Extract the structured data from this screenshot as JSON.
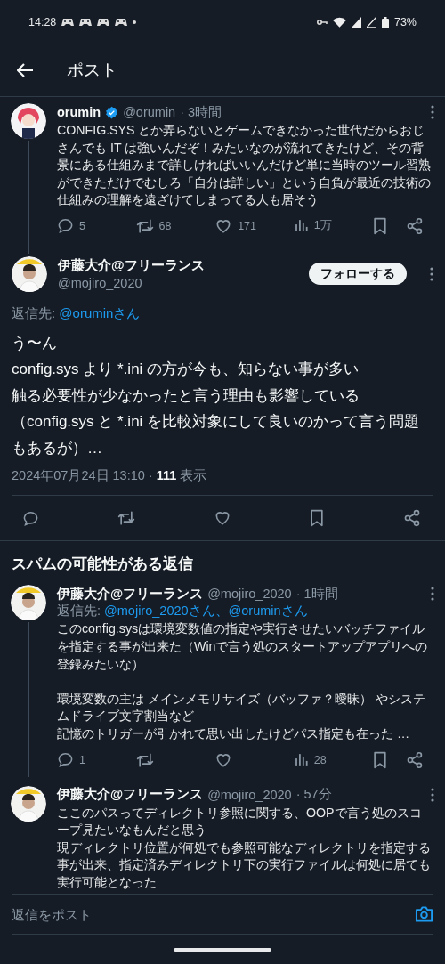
{
  "status_bar": {
    "time": "14:28",
    "battery": "73%"
  },
  "header": {
    "title": "ポスト"
  },
  "parent_post": {
    "name": "orumin",
    "verified": true,
    "handle": "@orumin",
    "time": "· 3時間",
    "connected": true,
    "paragraphs": [
      [
        "CONFIG.SYS とか弄らないとゲームできなかった世代だからおじさんでも IT は強いんだぞ！みたいなのが流れてきたけど、その背景にある仕組みまで詳しければいいんだけど単に当時のツール習熟ができただけでむしろ「自分は詳しい」という自負が最近の技術の仕組みの理解を遠ざけてしまってる人も居そう"
      ]
    ],
    "stats": {
      "replies": "5",
      "reposts": "68",
      "likes": "171",
      "views": "1万"
    }
  },
  "main_post": {
    "name": "伊藤大介@フリーランス",
    "handle": "@mojiro_2020",
    "follow_button": "フォローする",
    "reply_to_label": "返信先:",
    "reply_to": "@oruminさん",
    "paragraphs": [
      [
        "う〜ん",
        "config.sys より *.ini の方が今も、知らない事が多い",
        "触る必要性が少なかったと言う理由も影響している",
        "（config.sys と *.ini を比較対象にして良いのかって言う問題もあるが）…"
      ]
    ],
    "meta": "2024年07月24日 13:10 · **111** 表示"
  },
  "spam_section": {
    "title": "スパムの可能性がある返信"
  },
  "replies": [
    {
      "name": "伊藤大介@フリーランス",
      "verified": false,
      "handle": "@mojiro_2020",
      "time": "· 1時間",
      "connected": true,
      "reply_to_label": "返信先:",
      "reply_to": "@mojiro_2020さん、@oruminさん",
      "paragraphs": [
        [
          "このconfig.sysは環境変数値の指定や実行させたいバッチファイルを指定する事が出来た（Winで言う処のスタートアップアプリへの登録みたいな）"
        ],
        [
          "環境変数の主は メインメモリサイズ（バッファ？曖昧） やシステムドライブ文字割当など",
          "記憶のトリガーが引かれて思い出したけどパス指定も在った …"
        ]
      ],
      "stats": {
        "replies": "1",
        "views": "28"
      }
    },
    {
      "name": "伊藤大介@フリーランス",
      "verified": false,
      "handle": "@mojiro_2020",
      "time": "· 57分",
      "connected": false,
      "paragraphs": [
        [
          "ここのパスってディレクトリ参照に関する、OOPで言う処のスコープ見たいなもんだと思う",
          "現ディレクトリ位置が何処でも参照可能なディレクトリを指定する事が出来、指定済みディレクトリ下の実行ファイルは何処に居ても実行可能となった"
        ]
      ]
    }
  ],
  "compose": {
    "placeholder": "返信をポスト"
  }
}
